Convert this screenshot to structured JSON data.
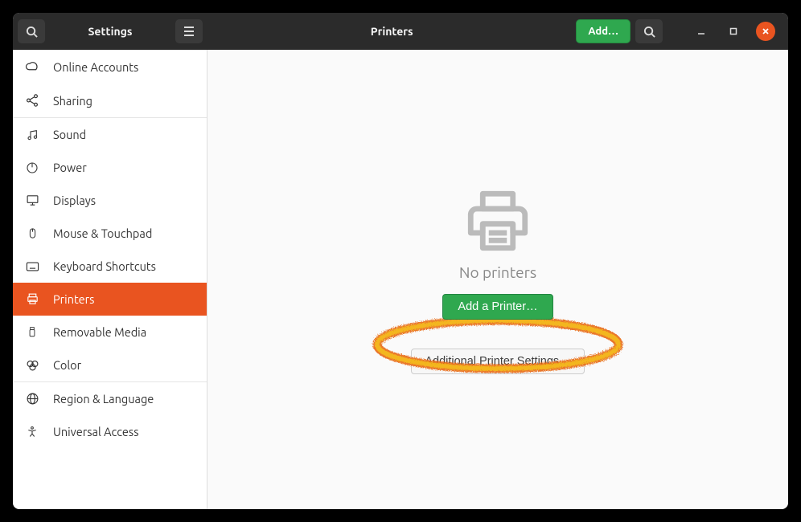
{
  "header": {
    "left_title": "Settings",
    "right_title": "Printers",
    "add_button": "Add…"
  },
  "sidebar": {
    "items": [
      {
        "label": "Online Accounts"
      },
      {
        "label": "Sharing"
      },
      {
        "label": "Sound"
      },
      {
        "label": "Power"
      },
      {
        "label": "Displays"
      },
      {
        "label": "Mouse & Touchpad"
      },
      {
        "label": "Keyboard Shortcuts"
      },
      {
        "label": "Printers"
      },
      {
        "label": "Removable Media"
      },
      {
        "label": "Color"
      },
      {
        "label": "Region & Language"
      },
      {
        "label": "Universal Access"
      }
    ]
  },
  "main": {
    "empty_state": "No printers",
    "primary_button": "Add a Printer…",
    "secondary_button": "Additional Printer Settings…"
  }
}
